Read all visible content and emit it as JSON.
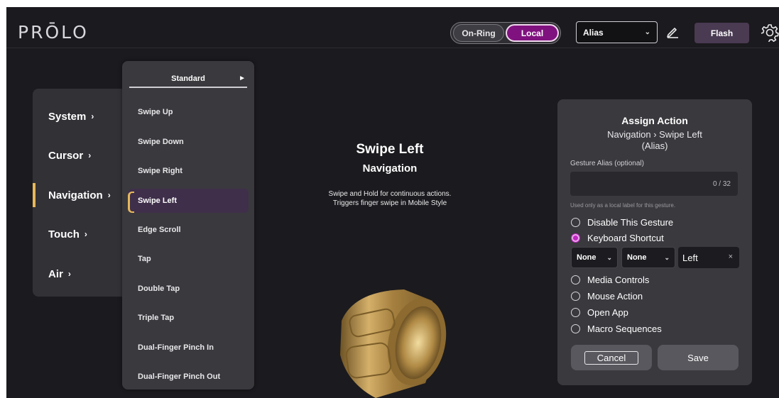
{
  "header": {
    "logo": "PRŌLO",
    "mode_toggle": {
      "on_ring": "On-Ring",
      "local": "Local",
      "selected": "Local"
    },
    "alias_select": "Alias",
    "flash_label": "Flash"
  },
  "categories": [
    {
      "label": "System",
      "arrow": "›",
      "active": false
    },
    {
      "label": "Cursor",
      "arrow": "›",
      "active": false
    },
    {
      "label": "Navigation",
      "arrow": "›",
      "active": true
    },
    {
      "label": "Touch",
      "arrow": "›",
      "active": false
    },
    {
      "label": "Air",
      "arrow": "›",
      "active": false
    }
  ],
  "gesture_menu": {
    "header": "Standard",
    "header_arrow": "►",
    "items": [
      "Swipe Up",
      "Swipe Down",
      "Swipe Right",
      "Swipe Left",
      "Edge Scroll",
      "Tap",
      "Double Tap",
      "Triple Tap",
      "Dual-Finger Pinch In",
      "Dual-Finger Pinch Out"
    ],
    "active_index": 3
  },
  "center": {
    "title": "Swipe Left",
    "subtitle": "Navigation",
    "description_line1": "Swipe and Hold for continuous actions.",
    "description_line2": "Triggers finger swipe in Mobile Style"
  },
  "assign": {
    "title": "Assign Action",
    "path": "Navigation › Swipe Left",
    "path_alias": "(Alias)",
    "alias_label": "Gesture Alias (optional)",
    "alias_value": "",
    "alias_count": "0 / 32",
    "alias_hint": "Used only as a local label for this gesture.",
    "options": {
      "disable": "Disable This Gesture",
      "keyboard": "Keyboard Shortcut",
      "media": "Media Controls",
      "mouse": "Mouse Action",
      "open_app": "Open App",
      "macro": "Macro Sequences"
    },
    "selected_option": "Keyboard Shortcut",
    "modifier1": "None",
    "modifier2": "None",
    "key": "Left",
    "key_clear": "×",
    "cancel_label": "Cancel",
    "save_label": "Save"
  },
  "colors": {
    "background": "#1b1a1e",
    "panel": "#3a393e",
    "accent_purple": "#80127f",
    "accent_gold": "#e7b85a",
    "ring_gold": "#b8934e"
  },
  "icons": {
    "edit": "pencil-icon",
    "settings": "gear-icon",
    "dropdown": "chevron-down-icon"
  }
}
